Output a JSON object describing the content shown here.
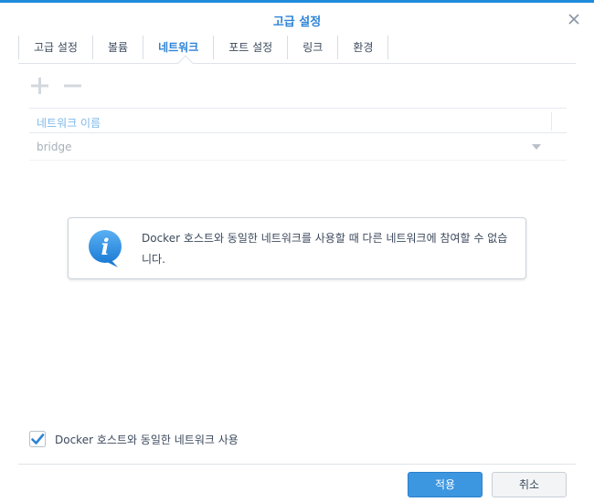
{
  "window": {
    "title": "고급 설정"
  },
  "tabs": [
    {
      "label": "고급 설정"
    },
    {
      "label": "볼륨"
    },
    {
      "label": "네트워크",
      "active": true
    },
    {
      "label": "포트 설정"
    },
    {
      "label": "링크"
    },
    {
      "label": "환경"
    }
  ],
  "toolbar": {
    "add_icon": "plus-icon",
    "remove_icon": "minus-icon"
  },
  "grid": {
    "column_header": "네트워크 이름",
    "rows": [
      {
        "value": "bridge"
      }
    ]
  },
  "info": {
    "icon": "info-icon",
    "text": "Docker 호스트와 동일한 네트워크를 사용할 때 다른 네트워크에 참여할 수 없습니다."
  },
  "checkbox": {
    "label": "Docker 호스트와 동일한 네트워크 사용",
    "checked": true
  },
  "buttons": {
    "apply": "적용",
    "cancel": "취소"
  },
  "colors": {
    "accent": "#2d83d6",
    "primary_button": "#3d96e0",
    "muted_text": "#a8b0ba"
  }
}
